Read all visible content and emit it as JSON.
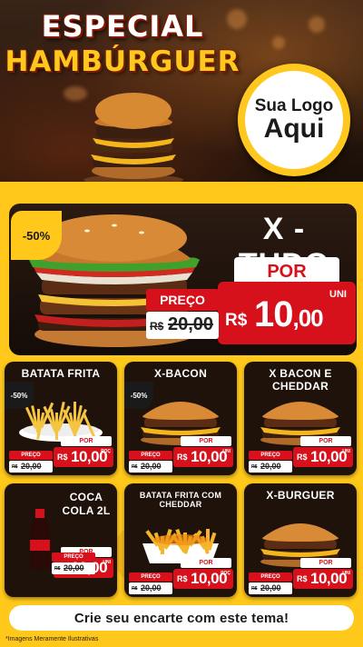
{
  "header": {
    "title_line1": "ESPECIAL",
    "title_line2": "HAMBÚRGUER",
    "logo_line1": "Sua Logo",
    "logo_line2": "Aqui"
  },
  "featured": {
    "badge": "-50%",
    "name": "X - TUDO",
    "por_label": "POR",
    "preco_label": "PREÇO",
    "old_currency": "R$",
    "old_price": "20,00",
    "currency": "R$",
    "price_int": "10",
    "price_dec": ",00",
    "unit": "UNI"
  },
  "cards": [
    {
      "title": "BATATA FRITA",
      "badge": "-50%",
      "unit": "POÇ",
      "image": "fries"
    },
    {
      "title": "X-BACON",
      "badge": "-50%",
      "unit": "UNI",
      "image": "burger"
    },
    {
      "title": "X BACON E CHEDDAR",
      "badge": "",
      "unit": "UNI",
      "image": "burger"
    },
    {
      "title": "COCA COLA 2L",
      "badge": "",
      "unit": "UNI",
      "image": "soda"
    },
    {
      "title": "BATATA FRITA COM CHEDDAR",
      "badge": "",
      "unit": "POÇ",
      "image": "fries-cheddar"
    },
    {
      "title": "X-BURGUER",
      "badge": "",
      "unit": "UNI",
      "image": "burger"
    }
  ],
  "card_price": {
    "preco_label": "PREÇO",
    "por_label": "POR",
    "old_currency": "R$",
    "old_price": "20,00",
    "currency": "R$",
    "price": "10,00"
  },
  "footer": {
    "cta": "Crie seu encarte com este tema!",
    "disclaimer": "*Imagens Meramente Ilustrativas"
  },
  "colors": {
    "accent_yellow": "#ffc81a",
    "accent_red": "#d6111b",
    "dark": "#1e120b"
  }
}
